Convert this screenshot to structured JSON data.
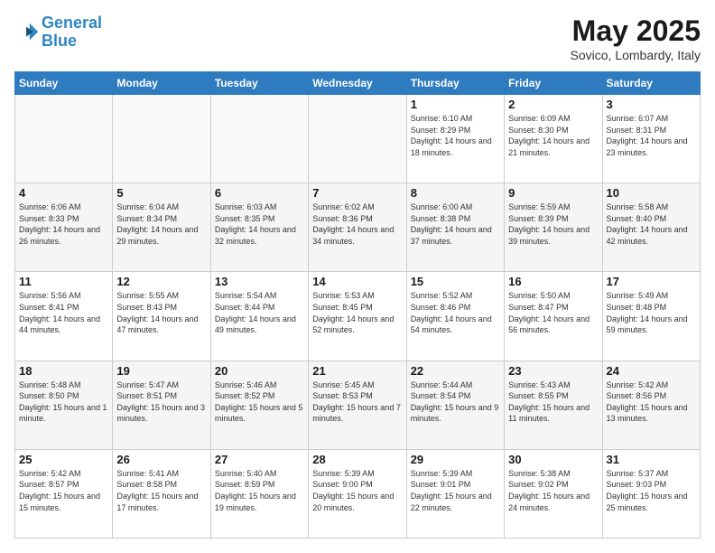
{
  "header": {
    "logo_line1": "General",
    "logo_line2": "Blue",
    "month_year": "May 2025",
    "location": "Sovico, Lombardy, Italy"
  },
  "weekdays": [
    "Sunday",
    "Monday",
    "Tuesday",
    "Wednesday",
    "Thursday",
    "Friday",
    "Saturday"
  ],
  "weeks": [
    [
      {
        "day": "",
        "info": ""
      },
      {
        "day": "",
        "info": ""
      },
      {
        "day": "",
        "info": ""
      },
      {
        "day": "",
        "info": ""
      },
      {
        "day": "1",
        "info": "Sunrise: 6:10 AM\nSunset: 8:29 PM\nDaylight: 14 hours\nand 18 minutes."
      },
      {
        "day": "2",
        "info": "Sunrise: 6:09 AM\nSunset: 8:30 PM\nDaylight: 14 hours\nand 21 minutes."
      },
      {
        "day": "3",
        "info": "Sunrise: 6:07 AM\nSunset: 8:31 PM\nDaylight: 14 hours\nand 23 minutes."
      }
    ],
    [
      {
        "day": "4",
        "info": "Sunrise: 6:06 AM\nSunset: 8:33 PM\nDaylight: 14 hours\nand 26 minutes."
      },
      {
        "day": "5",
        "info": "Sunrise: 6:04 AM\nSunset: 8:34 PM\nDaylight: 14 hours\nand 29 minutes."
      },
      {
        "day": "6",
        "info": "Sunrise: 6:03 AM\nSunset: 8:35 PM\nDaylight: 14 hours\nand 32 minutes."
      },
      {
        "day": "7",
        "info": "Sunrise: 6:02 AM\nSunset: 8:36 PM\nDaylight: 14 hours\nand 34 minutes."
      },
      {
        "day": "8",
        "info": "Sunrise: 6:00 AM\nSunset: 8:38 PM\nDaylight: 14 hours\nand 37 minutes."
      },
      {
        "day": "9",
        "info": "Sunrise: 5:59 AM\nSunset: 8:39 PM\nDaylight: 14 hours\nand 39 minutes."
      },
      {
        "day": "10",
        "info": "Sunrise: 5:58 AM\nSunset: 8:40 PM\nDaylight: 14 hours\nand 42 minutes."
      }
    ],
    [
      {
        "day": "11",
        "info": "Sunrise: 5:56 AM\nSunset: 8:41 PM\nDaylight: 14 hours\nand 44 minutes."
      },
      {
        "day": "12",
        "info": "Sunrise: 5:55 AM\nSunset: 8:43 PM\nDaylight: 14 hours\nand 47 minutes."
      },
      {
        "day": "13",
        "info": "Sunrise: 5:54 AM\nSunset: 8:44 PM\nDaylight: 14 hours\nand 49 minutes."
      },
      {
        "day": "14",
        "info": "Sunrise: 5:53 AM\nSunset: 8:45 PM\nDaylight: 14 hours\nand 52 minutes."
      },
      {
        "day": "15",
        "info": "Sunrise: 5:52 AM\nSunset: 8:46 PM\nDaylight: 14 hours\nand 54 minutes."
      },
      {
        "day": "16",
        "info": "Sunrise: 5:50 AM\nSunset: 8:47 PM\nDaylight: 14 hours\nand 56 minutes."
      },
      {
        "day": "17",
        "info": "Sunrise: 5:49 AM\nSunset: 8:48 PM\nDaylight: 14 hours\nand 59 minutes."
      }
    ],
    [
      {
        "day": "18",
        "info": "Sunrise: 5:48 AM\nSunset: 8:50 PM\nDaylight: 15 hours\nand 1 minute."
      },
      {
        "day": "19",
        "info": "Sunrise: 5:47 AM\nSunset: 8:51 PM\nDaylight: 15 hours\nand 3 minutes."
      },
      {
        "day": "20",
        "info": "Sunrise: 5:46 AM\nSunset: 8:52 PM\nDaylight: 15 hours\nand 5 minutes."
      },
      {
        "day": "21",
        "info": "Sunrise: 5:45 AM\nSunset: 8:53 PM\nDaylight: 15 hours\nand 7 minutes."
      },
      {
        "day": "22",
        "info": "Sunrise: 5:44 AM\nSunset: 8:54 PM\nDaylight: 15 hours\nand 9 minutes."
      },
      {
        "day": "23",
        "info": "Sunrise: 5:43 AM\nSunset: 8:55 PM\nDaylight: 15 hours\nand 11 minutes."
      },
      {
        "day": "24",
        "info": "Sunrise: 5:42 AM\nSunset: 8:56 PM\nDaylight: 15 hours\nand 13 minutes."
      }
    ],
    [
      {
        "day": "25",
        "info": "Sunrise: 5:42 AM\nSunset: 8:57 PM\nDaylight: 15 hours\nand 15 minutes."
      },
      {
        "day": "26",
        "info": "Sunrise: 5:41 AM\nSunset: 8:58 PM\nDaylight: 15 hours\nand 17 minutes."
      },
      {
        "day": "27",
        "info": "Sunrise: 5:40 AM\nSunset: 8:59 PM\nDaylight: 15 hours\nand 19 minutes."
      },
      {
        "day": "28",
        "info": "Sunrise: 5:39 AM\nSunset: 9:00 PM\nDaylight: 15 hours\nand 20 minutes."
      },
      {
        "day": "29",
        "info": "Sunrise: 5:39 AM\nSunset: 9:01 PM\nDaylight: 15 hours\nand 22 minutes."
      },
      {
        "day": "30",
        "info": "Sunrise: 5:38 AM\nSunset: 9:02 PM\nDaylight: 15 hours\nand 24 minutes."
      },
      {
        "day": "31",
        "info": "Sunrise: 5:37 AM\nSunset: 9:03 PM\nDaylight: 15 hours\nand 25 minutes."
      }
    ]
  ]
}
